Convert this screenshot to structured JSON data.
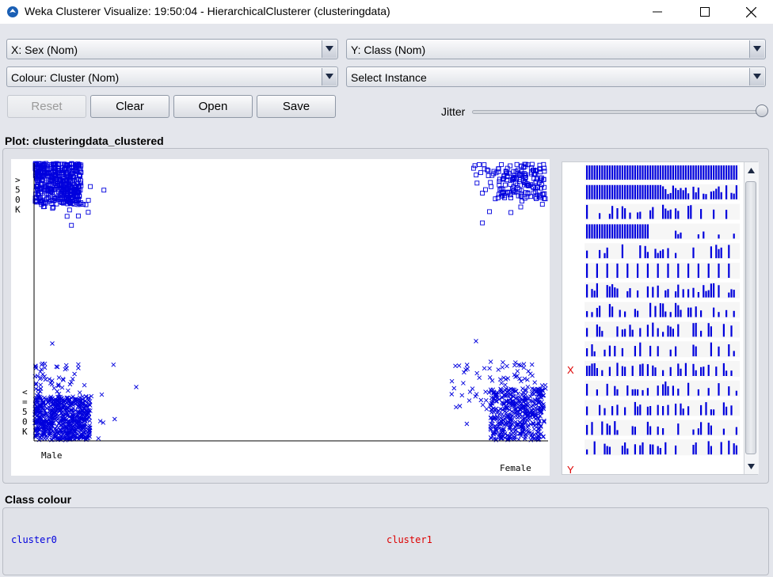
{
  "window": {
    "title": "Weka Clusterer Visualize: 19:50:04 - HierarchicalClusterer (clusteringdata)",
    "controls": [
      "minimize",
      "maximize",
      "close"
    ]
  },
  "toolbar": {
    "x_axis": "X: Sex (Nom)",
    "y_axis": "Y: Class (Nom)",
    "colour": "Colour: Cluster (Nom)",
    "select_instance": "Select Instance",
    "reset_label": "Reset",
    "clear_label": "Clear",
    "open_label": "Open",
    "save_label": "Save",
    "jitter_label": "Jitter",
    "jitter_level": 1.0
  },
  "plot": {
    "heading": "Plot: clusteringdata_clustered",
    "y_ticks": [
      ">50K",
      "<=50K"
    ],
    "x_ticks": [
      "Male",
      "Female"
    ]
  },
  "attribute_panel": {
    "markers": [
      "X",
      "Y"
    ],
    "row_count": 15
  },
  "class_colour": {
    "heading": "Class colour",
    "items": [
      {
        "label": "cluster0",
        "color": "#0000dd"
      },
      {
        "label": "cluster1",
        "color": "#dd0000"
      }
    ]
  },
  "colors": {
    "cluster0": "#0000dd",
    "cluster1": "#dd0000",
    "attribute_marker": "#dd0000"
  }
}
